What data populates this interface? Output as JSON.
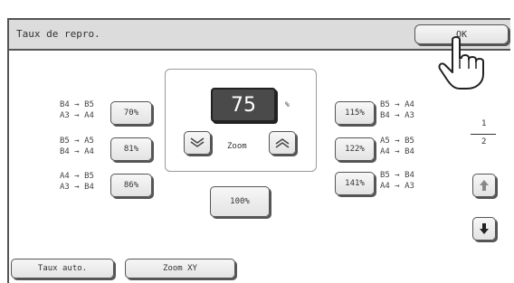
{
  "header": {
    "title": "Taux de repro.",
    "ok_label": "OK"
  },
  "zoom": {
    "value": "75",
    "unit": "%",
    "label": "Zoom"
  },
  "left_presets": [
    {
      "line1": "B4 → B5",
      "line2": "A3 → A4",
      "button": "70%"
    },
    {
      "line1": "B5 → A5",
      "line2": "B4 → A4",
      "button": "81%"
    },
    {
      "line1": "A4 → B5",
      "line2": "A3 → B4",
      "button": "86%"
    }
  ],
  "right_presets": [
    {
      "line1": "B5 → A4",
      "line2": "B4 → A3",
      "button": "115%"
    },
    {
      "line1": "A5 → B5",
      "line2": "A4 → B4",
      "button": "122%"
    },
    {
      "line1": "B5 → B4",
      "line2": "A4 → A3",
      "button": "141%"
    }
  ],
  "center_button": "100%",
  "pagination": {
    "current": "1",
    "total": "2"
  },
  "footer": {
    "auto_label": "Taux auto.",
    "xy_label": "Zoom XY"
  },
  "icons": {
    "decrease": "chevron-down-double-icon",
    "increase": "chevron-up-double-icon",
    "scroll_up": "arrow-up-icon",
    "scroll_down": "arrow-down-icon",
    "pointer": "hand-pointer-icon"
  }
}
